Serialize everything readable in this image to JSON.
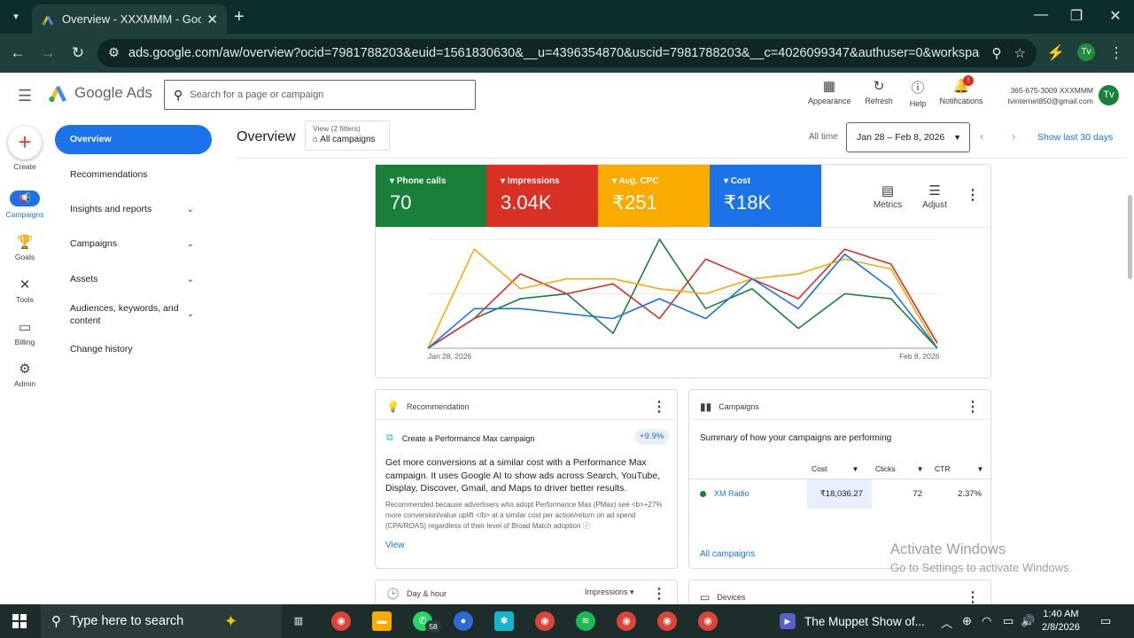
{
  "browser": {
    "tab_title": "Overview - XXXMMM - Google",
    "url": "ads.google.com/aw/overview?ocid=7981788203&euid=1561830630&__u=4396354870&uscid=7981788203&__c=4026099347&authuser=0&workspaceId=0&sub...",
    "profile_initials": "Tv"
  },
  "header": {
    "app_name": "Google Ads",
    "search_placeholder": "Search for a page or campaign",
    "actions": {
      "appearance": "Appearance",
      "refresh": "Refresh",
      "help": "Help",
      "notifications": "Notifications"
    },
    "notification_badge": "!",
    "account_id": "365-675-3009 XXXMMM",
    "account_email": "tvinternet850@gmail.com",
    "account_initials": "Tv"
  },
  "rail": {
    "create": "Create",
    "campaigns": "Campaigns",
    "goals": "Goals",
    "tools": "Tools",
    "billing": "Billing",
    "admin": "Admin"
  },
  "nav": {
    "overview": "Overview",
    "recommendations": "Recommendations",
    "insights": "Insights and reports",
    "campaigns": "Campaigns",
    "assets": "Assets",
    "audiences": "Audiences, keywords, and content",
    "change_history": "Change history"
  },
  "overview": {
    "title": "Overview",
    "filter_label": "View (2 filters)",
    "filter_value": "All campaigns",
    "all_time": "All time",
    "date_range": "Jan 28 – Feb 8, 2026",
    "show_last": "Show last 30 days"
  },
  "metrics": [
    {
      "label": "Phone calls",
      "value": "70",
      "color": "#188038"
    },
    {
      "label": "Impressions",
      "value": "3.04K",
      "color": "#d93025"
    },
    {
      "label": "Avg. CPC",
      "value": "₹251",
      "color": "#f9ab00"
    },
    {
      "label": "Cost",
      "value": "₹18K",
      "color": "#1a73e8"
    }
  ],
  "chart_tools": {
    "metrics": "Metrics",
    "adjust": "Adjust"
  },
  "chart_data": {
    "type": "line",
    "x": [
      "Jan 28",
      "Jan 29",
      "Jan 30",
      "Jan 31",
      "Feb 1",
      "Feb 2",
      "Feb 3",
      "Feb 4",
      "Feb 5",
      "Feb 6",
      "Feb 7",
      "Feb 8"
    ],
    "x_tick_labels": [
      "Jan 28, 2026",
      "Feb 8, 2026"
    ],
    "grid": true,
    "series": [
      {
        "color": "#188038",
        "values": [
          0,
          3,
          5,
          5.5,
          1.5,
          11,
          4,
          6,
          2,
          5.5,
          5,
          0
        ]
      },
      {
        "color": "#d93025",
        "values": [
          0,
          3,
          7.5,
          5.5,
          6.5,
          3,
          9,
          7,
          5,
          10,
          8.5,
          0.5
        ]
      },
      {
        "color": "#f9ab00",
        "values": [
          0,
          10,
          6,
          7,
          7,
          6,
          5.5,
          7,
          7.5,
          9,
          8,
          0
        ]
      },
      {
        "color": "#1a73e8",
        "values": [
          0,
          4,
          4,
          3.5,
          3,
          5,
          3,
          7,
          4,
          9.5,
          6,
          0
        ]
      }
    ]
  },
  "recommendation": {
    "header": "Recommendation",
    "item_title": "Create a Performance Max campaign",
    "badge": "+9.9%",
    "body": "Get more conversions at a similar cost with a Performance Max campaign. It uses Google AI to show ads across Search, YouTube, Display, Discover, Gmail, and Maps to driver better results.",
    "detail": "Recommended because advertisers who adopt Performance Max (PMax) see <b>+27% more conversion/value uplift </b> at a similar cost per action/return on ad spend (CPA/ROAS) regardless of their level of Broad Match adoption",
    "view": "View"
  },
  "campaigns_card": {
    "header": "Campaigns",
    "subtitle": "Summary of how your campaigns are performing",
    "columns": [
      "Cost",
      "Clicks",
      "CTR"
    ],
    "rows": [
      {
        "name": "XM Radio",
        "cost": "₹18,036.27",
        "clicks": "72",
        "ctr": "2.37%"
      }
    ],
    "footer_link": "All campaigns"
  },
  "day_hour": {
    "header": "Day & hour",
    "dropdown": "Impressions"
  },
  "devices": {
    "header": "Devices"
  },
  "watermark": {
    "line1": "Activate Windows",
    "line2": "Go to Settings to activate Windows."
  },
  "taskbar": {
    "search_placeholder": "Type here to search",
    "whatsapp_badge": "58",
    "media_title": "The Muppet Show of...",
    "time": "1:40 AM",
    "date": "2/8/2026"
  }
}
